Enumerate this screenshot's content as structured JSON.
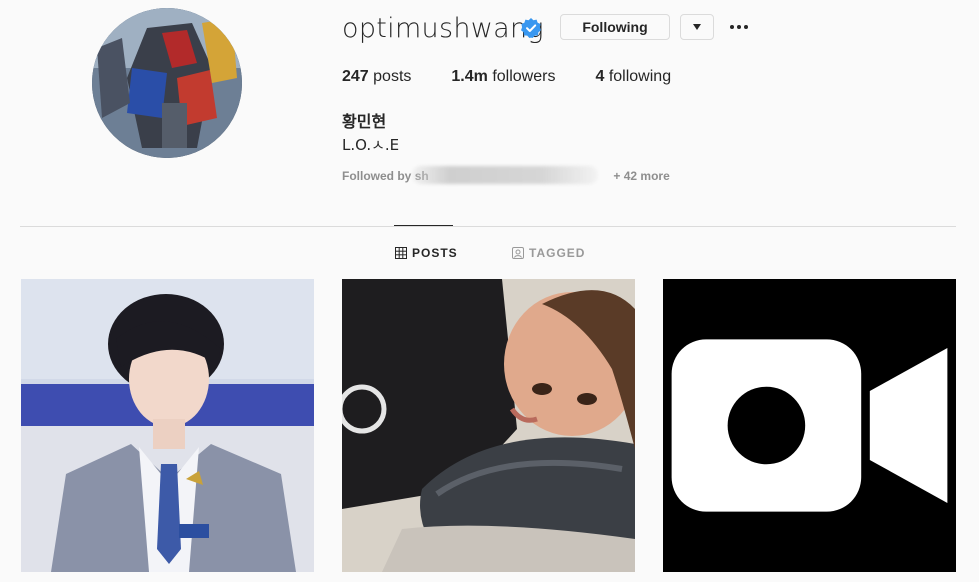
{
  "profile": {
    "username": "optimushwang",
    "verified": true,
    "following_label": "Following",
    "full_name": "황민현",
    "bio": "L.O.ㅅ.E",
    "followed_by_prefix": "Followed by",
    "followed_by_visible": "sh",
    "followed_by_suffix": "+ 42 more"
  },
  "stats": {
    "posts_count": "247",
    "posts_label": "posts",
    "followers_count": "1.4m",
    "followers_label": "followers",
    "following_count": "4",
    "following_label": "following"
  },
  "tabs": [
    {
      "label": "POSTS",
      "active": true
    },
    {
      "label": "TAGGED",
      "active": false
    }
  ],
  "posts": [
    {
      "kind": "photo"
    },
    {
      "kind": "photo"
    },
    {
      "kind": "video",
      "icon": "video-icon"
    }
  ],
  "colors": {
    "verified": "#3897f0",
    "text": "#262626",
    "muted": "#8e8e8e",
    "border": "#dbdbdb"
  }
}
